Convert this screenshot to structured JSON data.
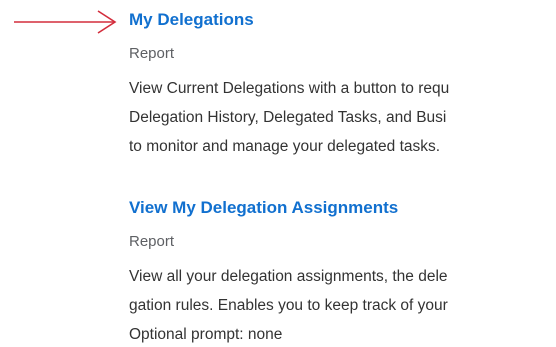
{
  "annotation": {
    "arrow_color": "#d32d3c",
    "arrow_icon": "arrow-right-icon"
  },
  "colors": {
    "link": "#1170cf",
    "meta": "#5e6064",
    "text": "#333333"
  },
  "results": [
    {
      "title": "My Delegations",
      "type": "Report",
      "description_lines": [
        "View Current Delegations with a button to requ",
        "Delegation History, Delegated Tasks, and Busi",
        "to monitor and manage your delegated tasks."
      ]
    },
    {
      "title": "View My Delegation Assignments",
      "type": "Report",
      "description_lines": [
        "View all your delegation assignments, the dele",
        "gation rules. Enables you to keep track of your",
        "Optional prompt: none"
      ]
    }
  ]
}
